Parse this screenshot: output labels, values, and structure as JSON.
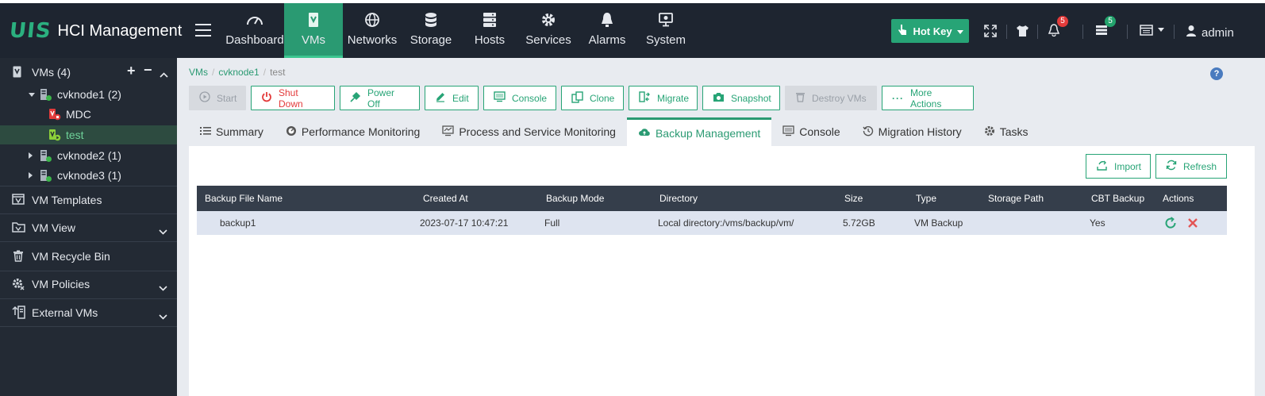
{
  "app": {
    "logo_mark": "UIS",
    "title": "HCI Management"
  },
  "nav": [
    {
      "label": "Dashboard",
      "icon": "gauge-icon"
    },
    {
      "label": "VMs",
      "icon": "vm-icon",
      "active": true
    },
    {
      "label": "Networks",
      "icon": "globe-icon"
    },
    {
      "label": "Storage",
      "icon": "database-icon"
    },
    {
      "label": "Hosts",
      "icon": "server-icon"
    },
    {
      "label": "Services",
      "icon": "gear-icon"
    },
    {
      "label": "Alarms",
      "icon": "alarm-bell-icon"
    },
    {
      "label": "System",
      "icon": "monitor-gear-icon"
    }
  ],
  "topright": {
    "hotkey_label": "Hot Key",
    "notifications_count": "5",
    "tasks_count": "5",
    "user": "admin"
  },
  "sidebar": {
    "vms_header": "VMs (4)",
    "tree": [
      {
        "label": "cvknode1 (2)"
      },
      {
        "label": "MDC"
      },
      {
        "label": "test"
      },
      {
        "label": "cvknode2 (1)"
      },
      {
        "label": "cvknode3 (1)"
      }
    ],
    "menu": [
      {
        "label": "VM Templates"
      },
      {
        "label": "VM View"
      },
      {
        "label": "VM Recycle Bin"
      },
      {
        "label": "VM Policies"
      },
      {
        "label": "External VMs"
      }
    ]
  },
  "breadcrumb": [
    "VMs",
    "cvknode1",
    "test"
  ],
  "actions": [
    {
      "label": "Start",
      "disabled": true
    },
    {
      "label": "Shut Down"
    },
    {
      "label": "Power Off"
    },
    {
      "label": "Edit"
    },
    {
      "label": "Console"
    },
    {
      "label": "Clone"
    },
    {
      "label": "Migrate"
    },
    {
      "label": "Snapshot"
    },
    {
      "label": "Destroy VMs",
      "disabled": true
    },
    {
      "label": "More Actions"
    }
  ],
  "tabs": [
    {
      "label": "Summary"
    },
    {
      "label": "Performance Monitoring"
    },
    {
      "label": "Process and Service Monitoring"
    },
    {
      "label": "Backup Management",
      "active": true
    },
    {
      "label": "Console"
    },
    {
      "label": "Migration History"
    },
    {
      "label": "Tasks"
    }
  ],
  "panel": {
    "import_label": "Import",
    "refresh_label": "Refresh"
  },
  "table": {
    "columns": [
      "Backup File Name",
      "Created At",
      "Backup Mode",
      "Directory",
      "Size",
      "Type",
      "Storage Path",
      "CBT Backup",
      "Actions"
    ],
    "rows": [
      [
        "backup1",
        "2023-07-17 10:47:21",
        "Full",
        "Local directory:/vms/backup/vm/",
        "5.72GB",
        "VM Backup",
        "",
        "Yes"
      ]
    ]
  },
  "colors": {
    "accent": "#27a476",
    "topbar": "#1e2530",
    "sidebar": "#232a34",
    "danger": "#e33b3b"
  }
}
